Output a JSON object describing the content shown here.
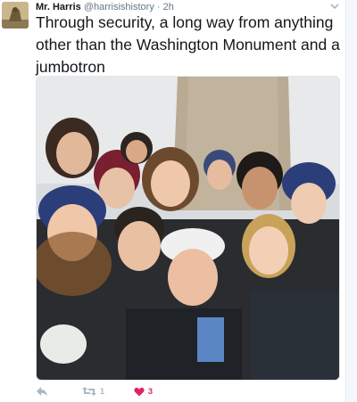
{
  "tweet": {
    "author_name": "Mr. Harris",
    "handle": "@harrisishistory",
    "separator": "·",
    "time": "2h",
    "text": "Through security, a long way from anything other than the Washington Monument and a jumbotron",
    "retweet_count": "1",
    "like_count": "3"
  },
  "icons": {
    "avatar": "profile-photo",
    "caret": "chevron-down-icon",
    "reply": "reply-icon",
    "retweet": "retweet-icon",
    "like": "heart-icon"
  },
  "colors": {
    "text": "#14171a",
    "secondary": "#657786",
    "icon_gray": "#aab8c2",
    "like_red": "#e0245e"
  }
}
